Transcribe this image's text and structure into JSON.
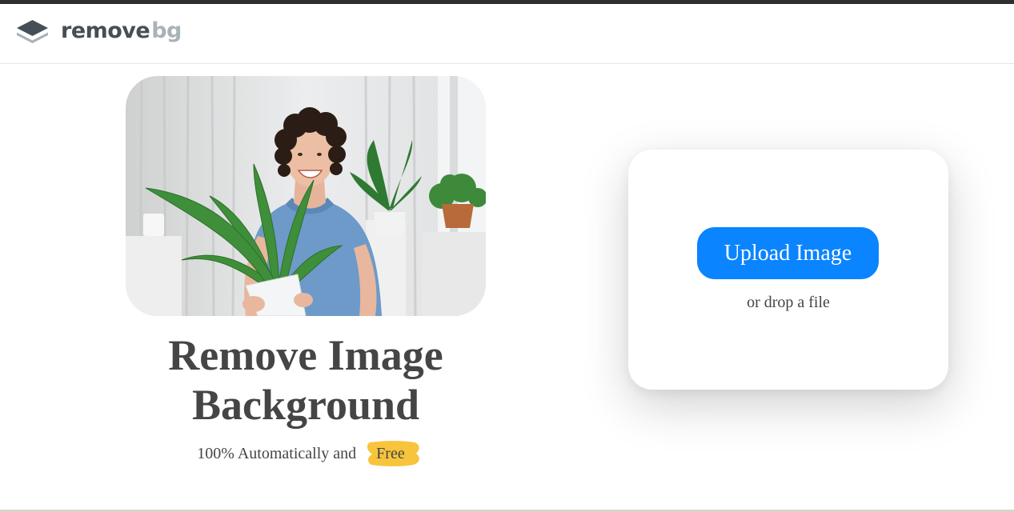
{
  "brand": {
    "logo_word_1": "remove",
    "logo_word_2": "bg",
    "colors": {
      "dark": "#454f57",
      "light": "#a9b2b9"
    }
  },
  "hero": {
    "image_alt": "man holding a potted plant",
    "title_line_1": "Remove Image",
    "title_line_2": "Background",
    "tagline": "100% Automatically and",
    "free_badge": "Free",
    "badge_color": "#f8c43c"
  },
  "upload": {
    "button_label": "Upload Image",
    "drop_text": "or drop a file",
    "button_color": "#0a84ff"
  },
  "icons": [
    "layers-logo-icon"
  ]
}
